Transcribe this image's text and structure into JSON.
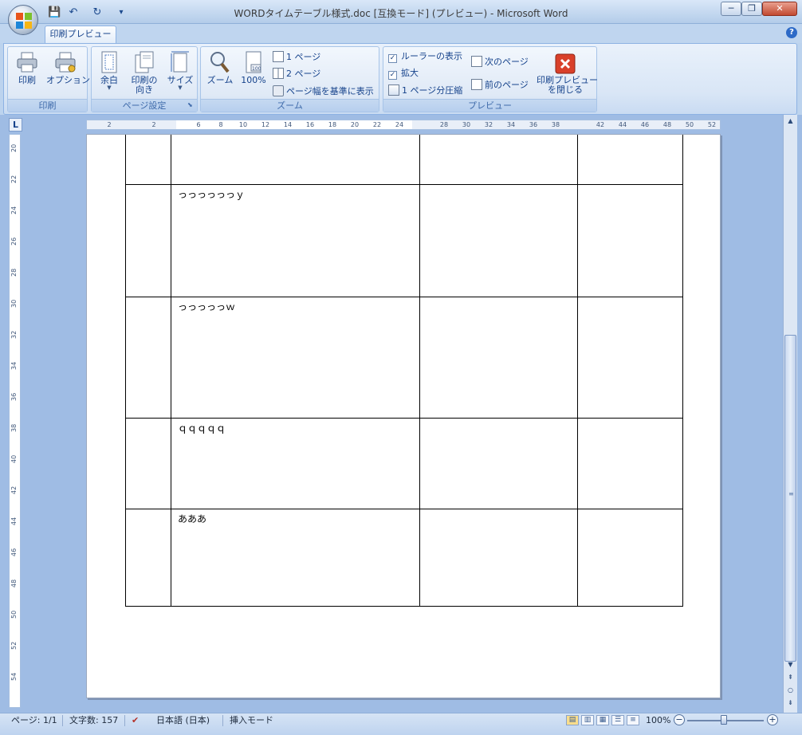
{
  "window": {
    "title": "WORDタイムテーブル様式.doc [互換モード] (プレビュー) - Microsoft Word",
    "minimize_label": "─",
    "maximize_label": "❐",
    "close_label": "✕"
  },
  "quick_access": {
    "save_icon": "💾",
    "undo_icon": "↶",
    "redo_icon": "↻",
    "customize_icon": "▾"
  },
  "tabs": [
    {
      "label": "印刷プレビュー",
      "active": true
    }
  ],
  "help_label": "?",
  "ribbon": {
    "print_group": {
      "label": "印刷",
      "print_button": "印刷",
      "options_button": "オプション"
    },
    "page_setup_group": {
      "label": "ページ設定",
      "margins_button": "余白",
      "orientation_button_line1": "印刷の",
      "orientation_button_line2": "向き",
      "size_button": "サイズ"
    },
    "zoom_group": {
      "label": "ズーム",
      "zoom_button": "ズーム",
      "percent_button": "100%",
      "one_page": "1 ページ",
      "two_pages": "2 ページ",
      "page_width": "ページ幅を基準に表示"
    },
    "preview_group": {
      "label": "プレビュー",
      "show_ruler": "ルーラーの表示",
      "magnifier": "拡大",
      "shrink_one_page": "1 ページ分圧縮",
      "next_page": "次のページ",
      "previous_page": "前のページ",
      "close_preview_line1": "印刷プレビュー",
      "close_preview_line2": "を閉じる"
    }
  },
  "ruler": {
    "corner_label": "L",
    "horizontal_numbers": [
      "2",
      "2",
      "6",
      "8",
      "10",
      "12",
      "14",
      "16",
      "18",
      "20",
      "22",
      "24",
      "28",
      "30",
      "32",
      "34",
      "36",
      "38",
      "42",
      "44",
      "46",
      "48",
      "50",
      "52"
    ],
    "vertical_numbers": [
      "20",
      "22",
      "24",
      "26",
      "28",
      "30",
      "32",
      "34",
      "36",
      "38",
      "40",
      "42",
      "44",
      "46",
      "48",
      "50",
      "52",
      "54"
    ]
  },
  "document": {
    "rows": [
      {
        "cells": [
          "",
          "",
          "",
          ""
        ]
      },
      {
        "cells": [
          "",
          "っっっっっっｙ",
          "",
          ""
        ]
      },
      {
        "cells": [
          "",
          "っっっっっｗ",
          "",
          ""
        ]
      },
      {
        "cells": [
          "",
          "ｑｑｑｑｑ",
          "",
          ""
        ]
      },
      {
        "cells": [
          "",
          "あああ",
          "",
          ""
        ]
      }
    ]
  },
  "status": {
    "page": "ページ: 1/1",
    "word_count": "文字数: 157",
    "language": "日本語 (日本)",
    "insert_mode": "挿入モード",
    "zoom_level": "100%",
    "zoom_minus": "−",
    "zoom_plus": "+"
  }
}
